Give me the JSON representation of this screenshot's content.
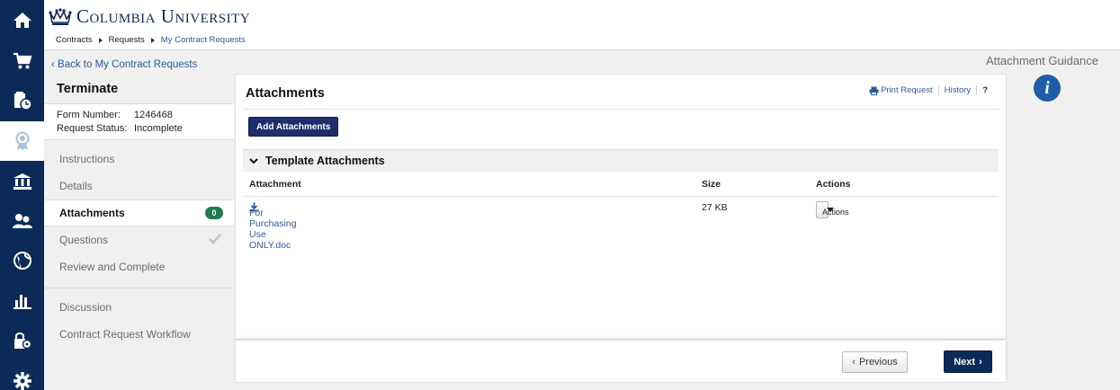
{
  "header": {
    "logo_text": "Columbia University",
    "breadcrumbs": [
      "Contracts",
      "Requests",
      "My Contract Requests"
    ]
  },
  "rail": {
    "icons": [
      "home-icon",
      "cart-icon",
      "contracts-clock-icon",
      "award-ribbon-icon",
      "bank-icon",
      "users-icon",
      "globe-icon",
      "chart-icon",
      "lock-gear-icon",
      "settings-icon"
    ],
    "active": "award-ribbon-icon",
    "color": "#0b2a57"
  },
  "left": {
    "back_link": "Back to My Contract Requests",
    "title": "Terminate",
    "form_number_label": "Form Number:",
    "form_number": "1246468",
    "status_label": "Request Status:",
    "status": "Incomplete",
    "nav": [
      {
        "label": "Instructions"
      },
      {
        "label": "Details"
      },
      {
        "label": "Attachments",
        "badge": "0"
      },
      {
        "label": "Questions"
      },
      {
        "label": "Review and Complete"
      }
    ],
    "nav2": [
      {
        "label": "Discussion"
      },
      {
        "label": "Contract Request Workflow"
      }
    ]
  },
  "main": {
    "title": "Attachments",
    "print_request": "Print Request",
    "history": "History",
    "help": "?",
    "add_button": "Add Attachments",
    "section_title": "Template Attachments",
    "columns": [
      "Attachment",
      "Size",
      "Actions"
    ],
    "rows": [
      {
        "attachment": "For Purchasing Use ONLY.doc",
        "size": "27 KB",
        "actions": "Actions"
      }
    ]
  },
  "footer": {
    "previous": "Previous",
    "next": "Next"
  },
  "right": {
    "guidance": "Attachment Guidance"
  },
  "colors": {
    "brand": "#0b2a57",
    "link": "#2e5b94",
    "badge": "#1e7b4e"
  }
}
